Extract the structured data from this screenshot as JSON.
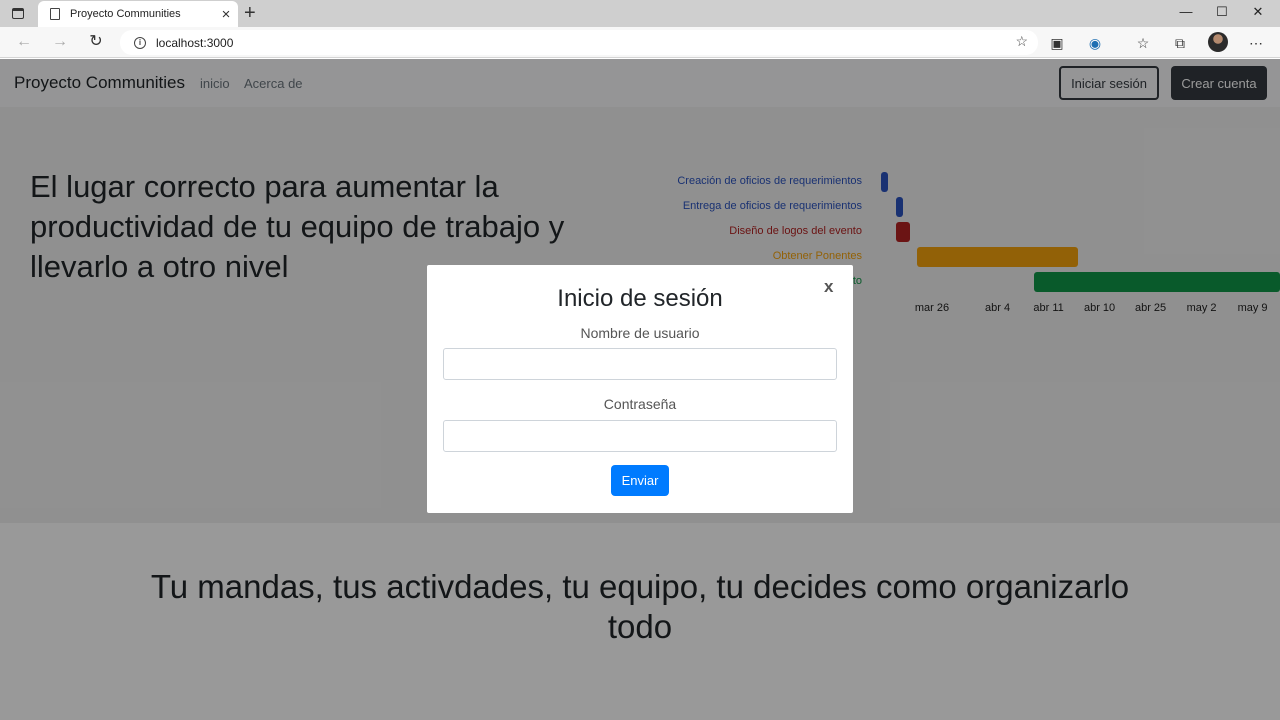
{
  "browser": {
    "tab_title": "Proyecto Communities",
    "tab_close": "×",
    "new_tab": "+",
    "url": "localhost:3000",
    "window_controls": {
      "minimize": "—",
      "maximize": "☐",
      "close": "✕"
    },
    "icons": [
      "back-icon",
      "forward-icon",
      "reload-icon",
      "info-icon",
      "favorite-star-icon",
      "extension-icon",
      "vpn-icon",
      "favorites-icon",
      "collections-icon",
      "profile-avatar",
      "more-icon"
    ]
  },
  "navbar": {
    "brand": "Proyecto Communities",
    "links": [
      "inicio",
      "Acerca de"
    ],
    "login_button": "Iniciar sesión",
    "signup_button": "Crear cuenta"
  },
  "hero": {
    "headline": "El lugar correcto para aumentar la productividad de tu equipo de trabajo y llevarlo a otro nivel"
  },
  "chart_data": {
    "type": "gantt",
    "tasks": [
      {
        "name": "Creación de oficios de requerimientos",
        "start": "2020-03-19",
        "end": "2020-03-20",
        "color": "#2a52be"
      },
      {
        "name": "Entrega de oficios de requerimientos",
        "start": "2020-03-21",
        "end": "2020-03-22",
        "color": "#2a52be"
      },
      {
        "name": "Diseño de logos del evento",
        "start": "2020-03-21",
        "end": "2020-03-23",
        "color": "#b22222"
      },
      {
        "name": "Obtener Ponentes",
        "start": "2020-03-24",
        "end": "2020-04-15",
        "color": "#f4a20c"
      },
      {
        "name": "to",
        "start": "2020-04-09",
        "end": "2020-05-20",
        "color": "#109648"
      }
    ],
    "x_ticks": [
      "mar 26",
      "abr 4",
      "abr 11",
      "abr 18",
      "abr 25",
      "may 2",
      "may 9"
    ],
    "x_tick_dates": [
      "2020-03-26",
      "2020-04-04",
      "2020-04-11",
      "2020-04-18",
      "2020-04-25",
      "2020-05-02",
      "2020-05-09"
    ],
    "visible_tick_labels": [
      "mar 26",
      "abr 4",
      "abr 11",
      "abr 10",
      "abr 25",
      "may 2",
      "may 9"
    ]
  },
  "lower": {
    "tagline": "Tu mandas, tus activdades, tu equipo, tu decides como organizarlo todo"
  },
  "modal": {
    "title": "Inicio de sesión",
    "close": "x",
    "username_label": "Nombre de usuario",
    "username_value": "",
    "password_label": "Contraseña",
    "password_value": "",
    "submit": "Enviar"
  }
}
